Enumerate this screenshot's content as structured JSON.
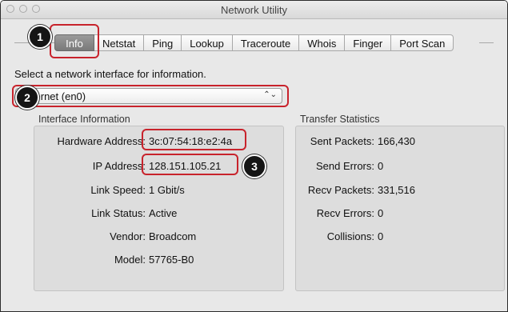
{
  "window": {
    "title": "Network Utility"
  },
  "tabs": [
    {
      "label": "Info"
    },
    {
      "label": "Netstat"
    },
    {
      "label": "Ping"
    },
    {
      "label": "Lookup"
    },
    {
      "label": "Traceroute"
    },
    {
      "label": "Whois"
    },
    {
      "label": "Finger"
    },
    {
      "label": "Port Scan"
    }
  ],
  "active_tab": "Info",
  "prompt": "Select a network interface for information.",
  "interface_select": {
    "value": "Ethernet (en0)",
    "arrows": "⌃⌄"
  },
  "interface_info": {
    "title": "Interface Information",
    "rows": [
      {
        "label": "Hardware Address:",
        "value": "3c:07:54:18:e2:4a"
      },
      {
        "label": "IP Address:",
        "value": "128.151.105.21"
      },
      {
        "label": "Link Speed:",
        "value": "1 Gbit/s"
      },
      {
        "label": "Link Status:",
        "value": "Active"
      },
      {
        "label": "Vendor:",
        "value": "Broadcom"
      },
      {
        "label": "Model:",
        "value": "57765-B0"
      }
    ]
  },
  "transfer_stats": {
    "title": "Transfer Statistics",
    "rows": [
      {
        "label": "Sent Packets:",
        "value": "166,430"
      },
      {
        "label": "Send Errors:",
        "value": "0"
      },
      {
        "label": "Recv Packets:",
        "value": "331,516"
      },
      {
        "label": "Recv Errors:",
        "value": "0"
      },
      {
        "label": "Collisions:",
        "value": "0"
      }
    ]
  },
  "callouts": {
    "one": "1",
    "two": "2",
    "three": "3"
  },
  "colors": {
    "highlight": "#c8232c",
    "active_tab": "#8a8a8a",
    "window_bg": "#e8e8e8"
  }
}
